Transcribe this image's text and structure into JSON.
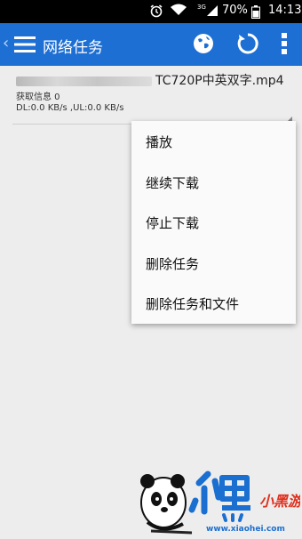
{
  "status": {
    "network": "3G",
    "battery": "70%",
    "time": "14:13"
  },
  "toolbar": {
    "title": "网络任务"
  },
  "task": {
    "file_suffix": "TC720P中英双字.mp4",
    "info": "获取信息 0",
    "speed": "DL:0.0 KB/s ,UL:0.0 KB/s"
  },
  "menu": {
    "items": [
      "播放",
      "继续下载",
      "停止下载",
      "删除任务",
      "删除任务和文件"
    ]
  },
  "watermark": {
    "brand": "小黑游戏",
    "url": "www.xiaohei.com"
  },
  "colors": {
    "accent": "#1e6fd4",
    "menu_bg": "#fafafa",
    "page_bg": "#ededed"
  }
}
